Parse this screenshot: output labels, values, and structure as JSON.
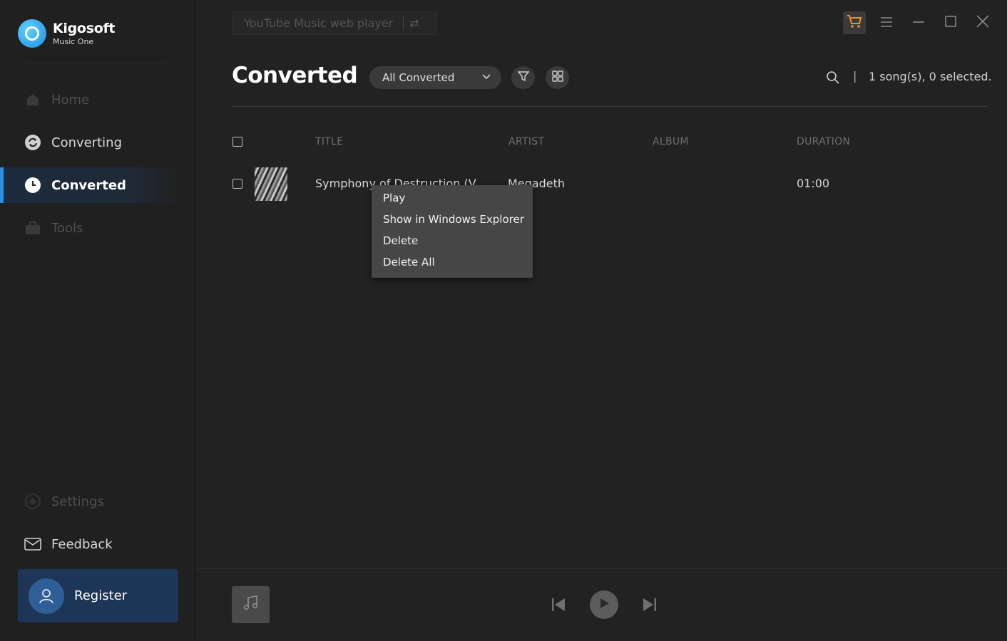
{
  "app": {
    "brand": "Kigosoft",
    "product": "Music One"
  },
  "source": {
    "label": "YouTube Music web player",
    "swap_glyph": "⇄"
  },
  "sidebar": {
    "items": [
      {
        "label": "Home",
        "icon": "home-icon",
        "state": "disabled"
      },
      {
        "label": "Converting",
        "icon": "converting-icon",
        "state": "normal"
      },
      {
        "label": "Converted",
        "icon": "clock-icon",
        "state": "active"
      },
      {
        "label": "Tools",
        "icon": "toolbox-icon",
        "state": "disabled"
      }
    ],
    "settings_label": "Settings",
    "feedback_label": "Feedback",
    "register_label": "Register"
  },
  "header": {
    "title": "Converted",
    "filter_value": "All Converted",
    "count": "1 song(s), 0 selected.",
    "divider": "|"
  },
  "table": {
    "columns": [
      "TITLE",
      "ARTIST",
      "ALBUM",
      "DURATION"
    ],
    "rows": [
      {
        "title": "Symphony of Destruction (V",
        "artist": "Megadeth",
        "album": "",
        "duration": "01:00"
      }
    ]
  },
  "context_menu": {
    "items": [
      "Play",
      "Show in Windows Explorer",
      "Delete",
      "Delete All"
    ]
  },
  "colors": {
    "accent": "#2d8ee8",
    "cart": "#f29125",
    "register_bg": "#1d3556"
  }
}
